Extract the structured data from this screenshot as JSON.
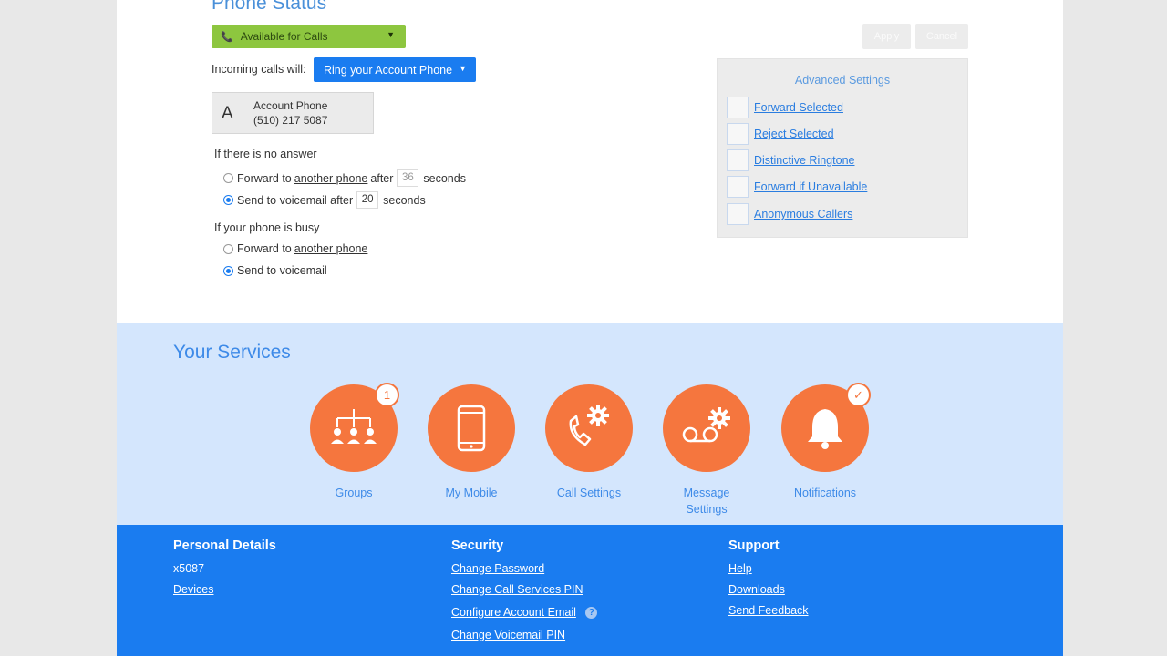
{
  "phone_status": {
    "title": "Phone Status",
    "status_value": "Available for Calls",
    "incoming_label": "Incoming calls will:",
    "ring_option": "Ring your Account Phone",
    "account_card": {
      "avatar_letter": "A",
      "name": "Account Phone",
      "number": "(510) 217 5087"
    },
    "no_answer": {
      "label": "If there is no answer",
      "forward_prefix": "Forward to",
      "forward_link": "another phone",
      "forward_mid": "after",
      "forward_seconds": "36",
      "voicemail_prefix": "Send to voicemail after",
      "voicemail_seconds": "20",
      "seconds_word": "seconds"
    },
    "busy": {
      "label": "If your phone is busy",
      "forward_prefix": "Forward to",
      "forward_link": "another phone",
      "voicemail": "Send to voicemail"
    },
    "apply_label": "Apply",
    "cancel_label": "Cancel"
  },
  "advanced": {
    "title": "Advanced Settings",
    "items": [
      "Forward Selected",
      "Reject Selected",
      "Distinctive Ringtone",
      "Forward if Unavailable",
      "Anonymous Callers"
    ]
  },
  "services": {
    "title": "Your Services",
    "items": [
      {
        "label": "Groups",
        "badge": "1",
        "icon": "groups-icon"
      },
      {
        "label": "My Mobile",
        "icon": "mobile-icon"
      },
      {
        "label": "Call Settings",
        "icon": "call-settings-icon"
      },
      {
        "label": "Message Settings",
        "icon": "message-settings-icon"
      },
      {
        "label": "Notifications",
        "badge": "✓",
        "icon": "bell-icon"
      }
    ]
  },
  "footer": {
    "personal": {
      "heading": "Personal Details",
      "extension": "x5087",
      "devices": "Devices"
    },
    "security": {
      "heading": "Security",
      "links": [
        "Change Password",
        "Change Call Services PIN",
        "Configure Account Email",
        "Change Voicemail PIN"
      ]
    },
    "support": {
      "heading": "Support",
      "links": [
        "Help",
        "Downloads",
        "Send Feedback"
      ]
    }
  },
  "colors": {
    "status_green": "#8dc63f",
    "brand_blue": "#1a7cf0",
    "service_orange": "#f5763e",
    "services_bg": "#d4e6fd"
  }
}
